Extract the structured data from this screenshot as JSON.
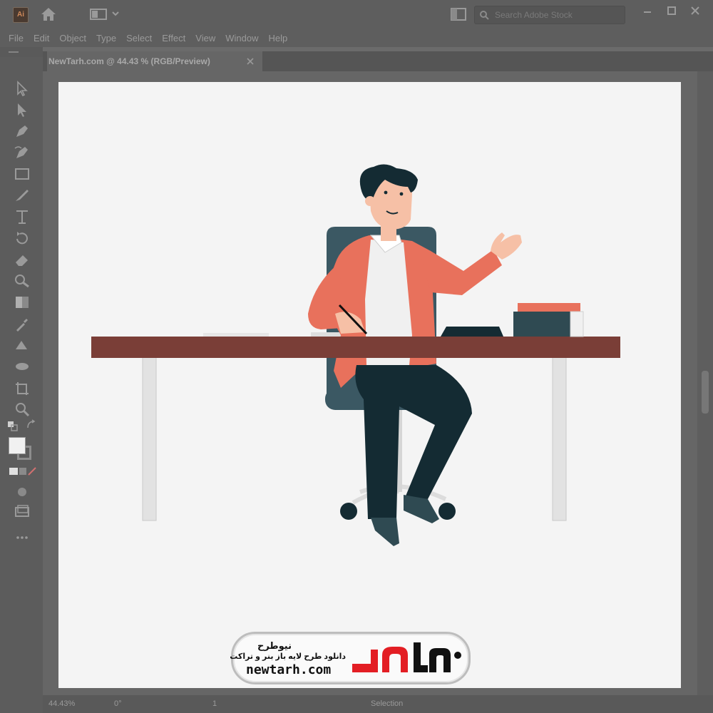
{
  "titlebar": {
    "app_name": "Ai",
    "search_placeholder": "Search Adobe Stock"
  },
  "menu": {
    "items": [
      "File",
      "Edit",
      "Object",
      "Type",
      "Select",
      "Effect",
      "View",
      "Window",
      "Help"
    ]
  },
  "document": {
    "tab_label": "NewTarh.com @ 44.43 % (RGB/Preview)"
  },
  "status": {
    "zoom": "44.43%",
    "rotation": "0°",
    "artboard_number": "1",
    "tool_name": "Selection"
  },
  "watermark": {
    "title": "نیوطرح",
    "subtitle": "دانلود طرح لایه باز بنر و تراکت",
    "url": "newtarh.com"
  },
  "colors": {
    "app_chrome": "#5e5e5e",
    "artboard": "#f4f4f4",
    "desk_top": "#7a3e37",
    "jacket": "#e8715c",
    "pants": "#142b33",
    "chair": "#3b5863",
    "logo_red": "#e31e24"
  }
}
